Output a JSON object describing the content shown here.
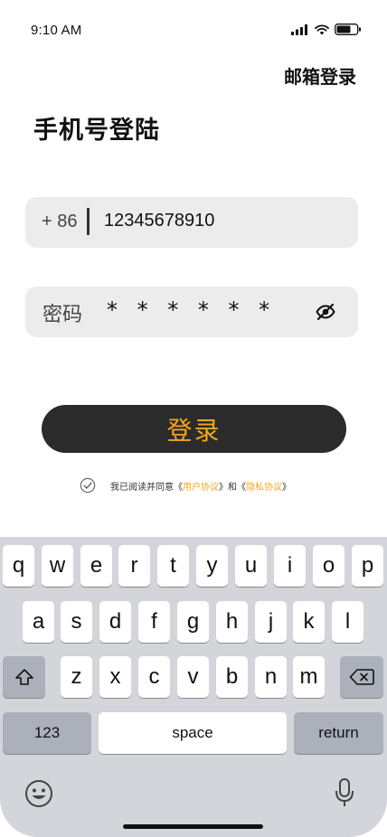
{
  "status_bar": {
    "time": "9:10 AM"
  },
  "header": {
    "email_login_label": "邮箱登录",
    "title": "手机号登陆"
  },
  "phone_field": {
    "prefix": "+ 86",
    "value": "12345678910"
  },
  "password_field": {
    "label": "密码",
    "value": "* * * * * *"
  },
  "login_button": {
    "label": "登录"
  },
  "agreement": {
    "prefix": "我已阅读并同意《",
    "user_agreement": "用户协议",
    "middle": "》和《",
    "privacy_agreement": "隐私协议",
    "suffix": "》"
  },
  "keyboard": {
    "row1": [
      "q",
      "w",
      "e",
      "r",
      "t",
      "y",
      "u",
      "i",
      "o",
      "p"
    ],
    "row2": [
      "a",
      "s",
      "d",
      "f",
      "g",
      "h",
      "j",
      "k",
      "l"
    ],
    "row3": [
      "z",
      "x",
      "c",
      "v",
      "b",
      "n",
      "m"
    ],
    "numbers_label": "123",
    "space_label": "space",
    "return_label": "return"
  },
  "colors": {
    "accent": "#f5a623",
    "button_bg": "#2b2b2b",
    "field_bg": "#ececec",
    "keyboard_bg": "#d3d5da"
  },
  "icons": [
    "signal-icon",
    "wifi-icon",
    "battery-icon",
    "eye-off-icon",
    "checkmark-circle-icon",
    "shift-icon",
    "backspace-icon",
    "emoji-icon",
    "microphone-icon"
  ]
}
